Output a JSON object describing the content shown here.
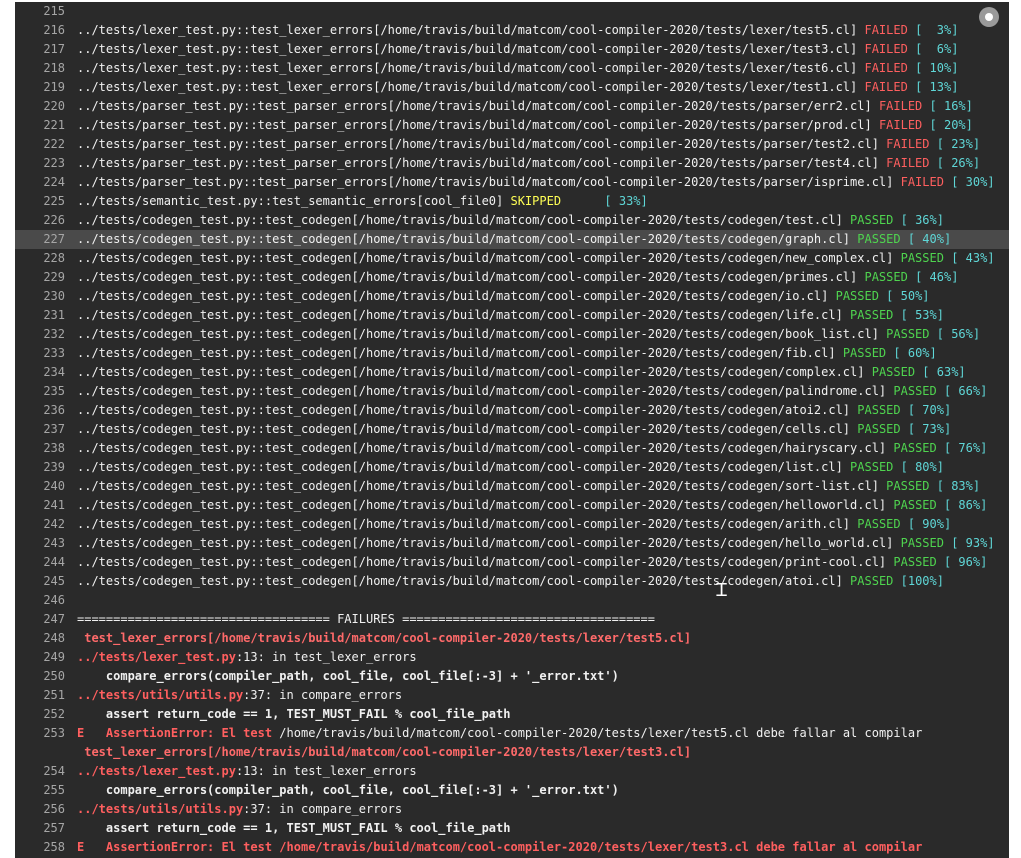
{
  "log": {
    "lines": [
      {
        "n": "215",
        "t": ""
      },
      {
        "n": "216",
        "t": "../tests/lexer_test.py::test_lexer_errors[/home/travis/build/matcom/cool-compiler-2020/tests/lexer/test5.cl] ",
        "s": "FAILED",
        "p": " [  3%]"
      },
      {
        "n": "217",
        "t": "../tests/lexer_test.py::test_lexer_errors[/home/travis/build/matcom/cool-compiler-2020/tests/lexer/test3.cl] ",
        "s": "FAILED",
        "p": " [  6%]"
      },
      {
        "n": "218",
        "t": "../tests/lexer_test.py::test_lexer_errors[/home/travis/build/matcom/cool-compiler-2020/tests/lexer/test6.cl] ",
        "s": "FAILED",
        "p": " [ 10%]"
      },
      {
        "n": "219",
        "t": "../tests/lexer_test.py::test_lexer_errors[/home/travis/build/matcom/cool-compiler-2020/tests/lexer/test1.cl] ",
        "s": "FAILED",
        "p": " [ 13%]"
      },
      {
        "n": "220",
        "t": "../tests/parser_test.py::test_parser_errors[/home/travis/build/matcom/cool-compiler-2020/tests/parser/err2.cl] ",
        "s": "FAILED",
        "p": " [ 16%]"
      },
      {
        "n": "221",
        "t": "../tests/parser_test.py::test_parser_errors[/home/travis/build/matcom/cool-compiler-2020/tests/parser/prod.cl] ",
        "s": "FAILED",
        "p": " [ 20%]"
      },
      {
        "n": "222",
        "t": "../tests/parser_test.py::test_parser_errors[/home/travis/build/matcom/cool-compiler-2020/tests/parser/test2.cl] ",
        "s": "FAILED",
        "p": " [ 23%]"
      },
      {
        "n": "223",
        "t": "../tests/parser_test.py::test_parser_errors[/home/travis/build/matcom/cool-compiler-2020/tests/parser/test4.cl] ",
        "s": "FAILED",
        "p": " [ 26%]"
      },
      {
        "n": "224",
        "t": "../tests/parser_test.py::test_parser_errors[/home/travis/build/matcom/cool-compiler-2020/tests/parser/isprime.cl] ",
        "s": "FAILED",
        "p": " [ 30%]"
      },
      {
        "n": "225",
        "t": "../tests/semantic_test.py::test_semantic_errors[cool_file0] ",
        "s": "SKIPPED",
        "p": "      [ 33%]"
      },
      {
        "n": "226",
        "t": "../tests/codegen_test.py::test_codegen[/home/travis/build/matcom/cool-compiler-2020/tests/codegen/test.cl] ",
        "s": "PASSED",
        "p": " [ 36%]"
      },
      {
        "n": "227",
        "t": "../tests/codegen_test.py::test_codegen[/home/travis/build/matcom/cool-compiler-2020/tests/codegen/graph.cl] ",
        "s": "PASSED",
        "p": " [ 40%]",
        "hl": true
      },
      {
        "n": "228",
        "t": "../tests/codegen_test.py::test_codegen[/home/travis/build/matcom/cool-compiler-2020/tests/codegen/new_complex.cl] ",
        "s": "PASSED",
        "p": " [ 43%]"
      },
      {
        "n": "229",
        "t": "../tests/codegen_test.py::test_codegen[/home/travis/build/matcom/cool-compiler-2020/tests/codegen/primes.cl] ",
        "s": "PASSED",
        "p": " [ 46%]"
      },
      {
        "n": "230",
        "t": "../tests/codegen_test.py::test_codegen[/home/travis/build/matcom/cool-compiler-2020/tests/codegen/io.cl] ",
        "s": "PASSED",
        "p": " [ 50%]"
      },
      {
        "n": "231",
        "t": "../tests/codegen_test.py::test_codegen[/home/travis/build/matcom/cool-compiler-2020/tests/codegen/life.cl] ",
        "s": "PASSED",
        "p": " [ 53%]"
      },
      {
        "n": "232",
        "t": "../tests/codegen_test.py::test_codegen[/home/travis/build/matcom/cool-compiler-2020/tests/codegen/book_list.cl] ",
        "s": "PASSED",
        "p": " [ 56%]"
      },
      {
        "n": "233",
        "t": "../tests/codegen_test.py::test_codegen[/home/travis/build/matcom/cool-compiler-2020/tests/codegen/fib.cl] ",
        "s": "PASSED",
        "p": " [ 60%]"
      },
      {
        "n": "234",
        "t": "../tests/codegen_test.py::test_codegen[/home/travis/build/matcom/cool-compiler-2020/tests/codegen/complex.cl] ",
        "s": "PASSED",
        "p": " [ 63%]"
      },
      {
        "n": "235",
        "t": "../tests/codegen_test.py::test_codegen[/home/travis/build/matcom/cool-compiler-2020/tests/codegen/palindrome.cl] ",
        "s": "PASSED",
        "p": " [ 66%]"
      },
      {
        "n": "236",
        "t": "../tests/codegen_test.py::test_codegen[/home/travis/build/matcom/cool-compiler-2020/tests/codegen/atoi2.cl] ",
        "s": "PASSED",
        "p": " [ 70%]"
      },
      {
        "n": "237",
        "t": "../tests/codegen_test.py::test_codegen[/home/travis/build/matcom/cool-compiler-2020/tests/codegen/cells.cl] ",
        "s": "PASSED",
        "p": " [ 73%]"
      },
      {
        "n": "238",
        "t": "../tests/codegen_test.py::test_codegen[/home/travis/build/matcom/cool-compiler-2020/tests/codegen/hairyscary.cl] ",
        "s": "PASSED",
        "p": " [ 76%]"
      },
      {
        "n": "239",
        "t": "../tests/codegen_test.py::test_codegen[/home/travis/build/matcom/cool-compiler-2020/tests/codegen/list.cl] ",
        "s": "PASSED",
        "p": " [ 80%]"
      },
      {
        "n": "240",
        "t": "../tests/codegen_test.py::test_codegen[/home/travis/build/matcom/cool-compiler-2020/tests/codegen/sort-list.cl] ",
        "s": "PASSED",
        "p": " [ 83%]"
      },
      {
        "n": "241",
        "t": "../tests/codegen_test.py::test_codegen[/home/travis/build/matcom/cool-compiler-2020/tests/codegen/helloworld.cl] ",
        "s": "PASSED",
        "p": " [ 86%]"
      },
      {
        "n": "242",
        "t": "../tests/codegen_test.py::test_codegen[/home/travis/build/matcom/cool-compiler-2020/tests/codegen/arith.cl] ",
        "s": "PASSED",
        "p": " [ 90%]"
      },
      {
        "n": "243",
        "t": "../tests/codegen_test.py::test_codegen[/home/travis/build/matcom/cool-compiler-2020/tests/codegen/hello_world.cl] ",
        "s": "PASSED",
        "p": " [ 93%]"
      },
      {
        "n": "244",
        "t": "../tests/codegen_test.py::test_codegen[/home/travis/build/matcom/cool-compiler-2020/tests/codegen/print-cool.cl] ",
        "s": "PASSED",
        "p": " [ 96%]"
      },
      {
        "n": "245",
        "t": "../tests/codegen_test.py::test_codegen[/home/travis/build/matcom/cool-compiler-2020/tests/codegen/atoi.cl] ",
        "s": "PASSED",
        "p": " [100%]"
      },
      {
        "n": "246",
        "t": ""
      },
      {
        "n": "247",
        "t": "=================================== FAILURES ==================================="
      },
      {
        "n": "248",
        "k": "failtitle",
        "t": " test_lexer_errors[/home/travis/build/matcom/cool-compiler-2020/tests/lexer/test5.cl]"
      },
      {
        "n": "249",
        "k": "frame",
        "path": "../tests/lexer_test.py",
        "rest": ":13: in test_lexer_errors"
      },
      {
        "n": "250",
        "k": "code",
        "t": "    compare_errors(compiler_path, cool_file, cool_file[:-3] + '_error.txt')"
      },
      {
        "n": "251",
        "k": "frame",
        "path": "../tests/utils/utils.py",
        "rest": ":37: in compare_errors"
      },
      {
        "n": "252",
        "k": "code",
        "t": "    assert return_code == 1, TEST_MUST_FAIL % cool_file_path"
      },
      {
        "n": "253",
        "k": "err",
        "e": "E   ",
        "msg": "AssertionError: El test ",
        "rest": "/home/travis/build/matcom/cool-compiler-2020/tests/lexer/test5.cl debe fallar al compilar"
      },
      {
        "n": "",
        "k": "failtitle",
        "t": " test_lexer_errors[/home/travis/build/matcom/cool-compiler-2020/tests/lexer/test3.cl]"
      },
      {
        "n": "254",
        "k": "frame",
        "path": "../tests/lexer_test.py",
        "rest": ":13: in test_lexer_errors"
      },
      {
        "n": "255",
        "k": "code",
        "t": "    compare_errors(compiler_path, cool_file, cool_file[:-3] + '_error.txt')"
      },
      {
        "n": "256",
        "k": "frame",
        "path": "../tests/utils/utils.py",
        "rest": ":37: in compare_errors"
      },
      {
        "n": "257",
        "k": "code",
        "t": "    assert return_code == 1, TEST_MUST_FAIL % cool_file_path"
      },
      {
        "n": "258",
        "k": "errbold",
        "e": "E   ",
        "msg": "AssertionError: El test /home/travis/build/matcom/cool-compiler-2020/tests/lexer/test3.cl debe fallar al compilar"
      }
    ]
  },
  "colors": {
    "failed": "#ff5f5f",
    "passed": "#4fd44f",
    "skipped": "#ffff55",
    "percent": "#5fd7d7",
    "background": "#2a2a2a"
  }
}
